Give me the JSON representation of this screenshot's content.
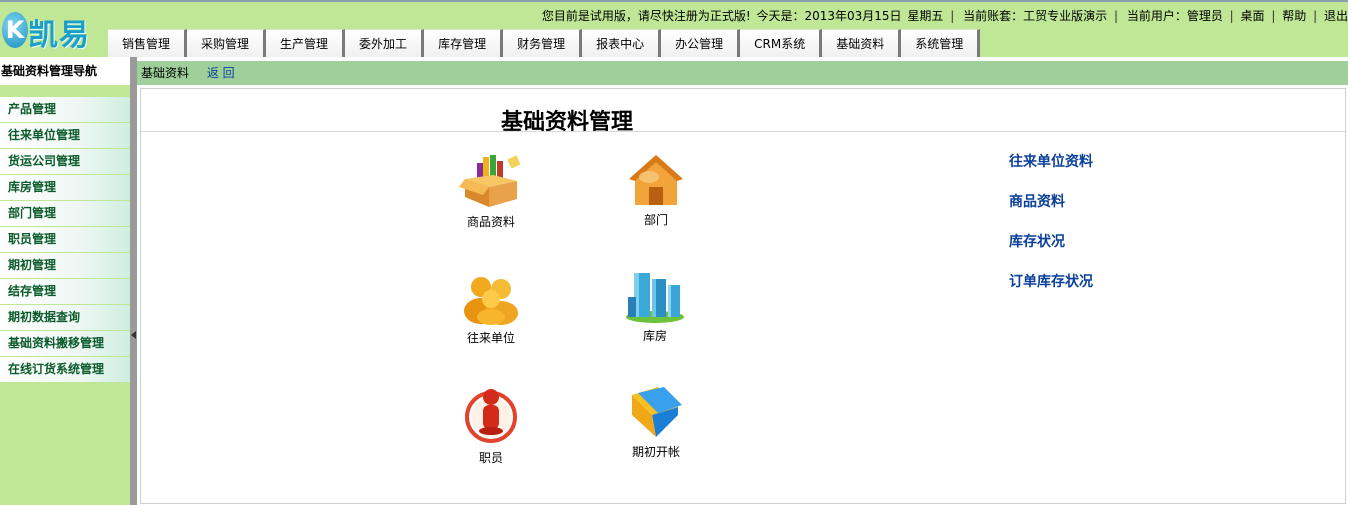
{
  "header": {
    "logo_letter": "K",
    "logo_text": "凯易通",
    "notice": "您目前是试用版，请尽快注册为正式版!",
    "today_label": "今天是：2013年03月15日",
    "weekday": "星期五",
    "account": "当前账套：工贸专业版演示",
    "user": "当前用户：管理员",
    "links": {
      "desktop": "桌面",
      "help": "帮助",
      "logout": "退出"
    },
    "separator": "|"
  },
  "menu": {
    "items": [
      "销售管理",
      "采购管理",
      "生产管理",
      "委外加工",
      "库存管理",
      "财务管理",
      "报表中心",
      "办公管理",
      "CRM系统",
      "基础资料",
      "系统管理"
    ]
  },
  "sidebar": {
    "title": "基础资料管理导航",
    "items": [
      "产品管理",
      "往来单位管理",
      "货运公司管理",
      "库房管理",
      "部门管理",
      "职员管理",
      "期初管理",
      "结存管理",
      "期初数据查询",
      "基础资料搬移管理",
      "在线订货系统管理"
    ]
  },
  "breadcrumb": {
    "current": "基础资料",
    "back": "返 回"
  },
  "main": {
    "title": "基础资料管理",
    "tiles": {
      "goods": "商品资料",
      "dept": "部门",
      "partners": "往来单位",
      "warehouse": "库房",
      "staff": "职员",
      "opening": "期初开帐"
    },
    "quick_links": [
      "往来单位资料",
      "商品资料",
      "库存状况",
      "订单库存状况"
    ]
  },
  "colors": {
    "header_bg": "#bfe796",
    "crumb_bg": "#9fcf9a",
    "link_blue": "#0a3f9a",
    "sidebar_text": "#0b5c2a"
  },
  "icons": [
    "box-chart-icon",
    "house-icon",
    "people-icon",
    "buildings-icon",
    "info-person-icon",
    "folder-icon",
    "collapse-arrow-icon"
  ]
}
